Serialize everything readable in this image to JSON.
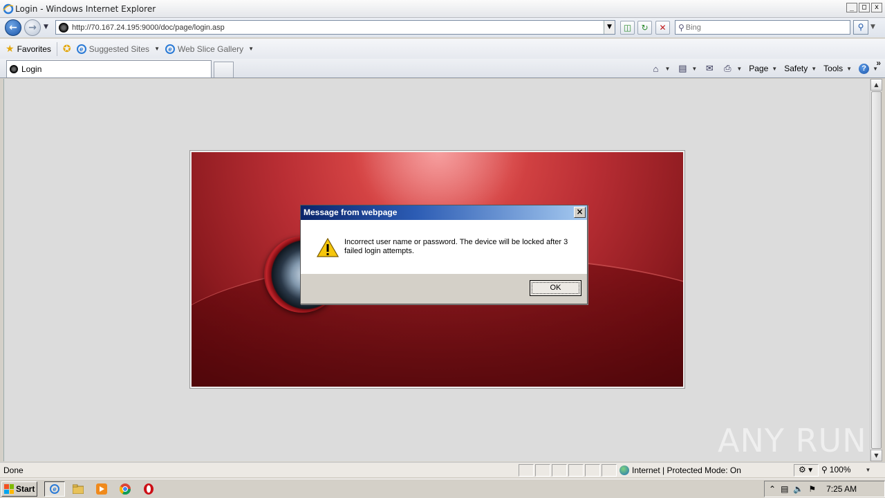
{
  "window": {
    "title": "Login - Windows Internet Explorer",
    "controls": [
      "_",
      "□",
      "x"
    ]
  },
  "address_bar": {
    "url": "http://70.167.24.195:9000/doc/page/login.asp"
  },
  "search": {
    "placeholder": "Bing"
  },
  "favorites_bar": {
    "favorites_label": "Favorites",
    "items": [
      {
        "label": "Suggested Sites",
        "icon": "ie-icon"
      },
      {
        "label": "Web Slice Gallery",
        "icon": "ie-icon"
      }
    ]
  },
  "tabs": [
    {
      "label": "Login",
      "active": true
    }
  ],
  "command_bar": {
    "page": "Page",
    "safety": "Safety",
    "tools": "Tools"
  },
  "dialog": {
    "title": "Message from webpage",
    "message": "Incorrect user name or password. The device will be locked after 3 failed login attempts.",
    "ok_label": "OK",
    "icon": "warning-icon"
  },
  "status_bar": {
    "status": "Done",
    "zone": "Internet | Protected Mode: On",
    "zoom": "100%"
  },
  "taskbar": {
    "start_label": "Start",
    "clock": "7:25 AM"
  },
  "watermark": "ANY RUN",
  "colors": {
    "dialog_title_start": "#0a246a",
    "dialog_title_end": "#a6caf0",
    "login_panel": "#b92e34"
  }
}
